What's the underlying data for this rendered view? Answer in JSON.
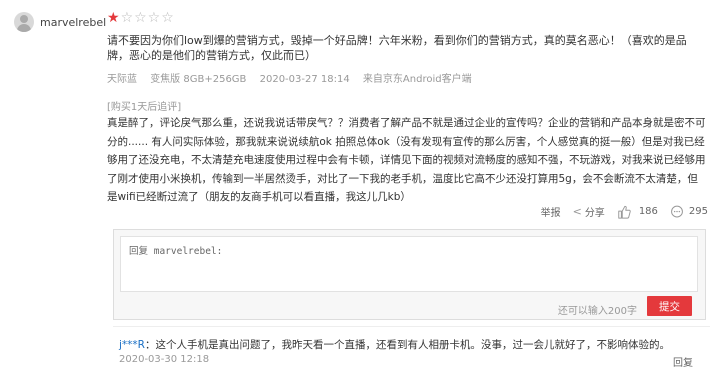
{
  "user": {
    "name": "marvelrebel"
  },
  "rating": {
    "stars": 1,
    "max": 5,
    "full_star": "★",
    "empty_stars": "☆☆☆☆"
  },
  "comment": {
    "text": "请不要因为你们low到爆的营销方式，毁掉一个好品牌！六年米粉，看到你们的营销方式，真的莫名恶心！（喜欢的是品牌，恶心的是他们的营销方式，仅此而已）",
    "color": "天际蓝",
    "version": "变焦版 8GB+256GB",
    "datetime": "2020-03-27 18:14",
    "source": "来自京东Android客户端"
  },
  "append": {
    "title": "[购买1天后追评]",
    "text": "真是醉了，评论戾气那么重，还说我说话带戾气？？消费者了解产品不就是通过企业的宣传吗？企业的营销和产品本身就是密不可分的...... 有人问实际体验，那我就来说说续航ok 拍照总体ok（没有发现有宣传的那么厉害，个人感觉真的挺一般）但是对我已经够用了还没充电，不太清楚充电速度使用过程中会有卡顿，详情见下面的视频对流畅度的感知不强，不玩游戏，对我来说已经够用了刚才使用小米换机，传输到一半居然烫手，对比了一下我的老手机，温度比它高不少还没打算用5g，会不会断流不太清楚，但是wifi已经断过流了（朋友的友商手机可以看直播，我这儿几kb）"
  },
  "actions": {
    "report": "举报",
    "share": "分享",
    "likes": "186",
    "comments": "295"
  },
  "reply_box": {
    "placeholder": "回复 marvelrebel:",
    "limit_text": "还可以输入200字",
    "submit_label": "提交"
  },
  "sub_reply": {
    "user": "j***R",
    "text": "：这个人手机是真出问题了，我昨天看一个直播，还看到有人相册卡机。没事，过一会儿就好了，不影响体验的。",
    "date": "2020-03-30 12:18",
    "reply_label": "回复"
  },
  "colors": {
    "accent": "#e4393c",
    "link": "#1a6fc4"
  }
}
